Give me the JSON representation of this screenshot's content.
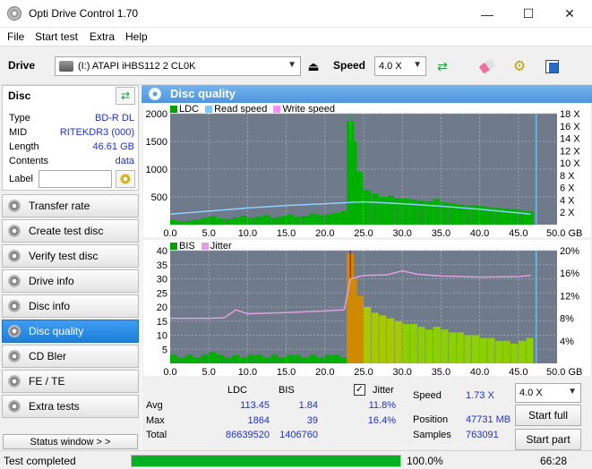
{
  "window": {
    "title": "Opti Drive Control 1.70",
    "minimize": "—",
    "maximize": "☐",
    "close": "✕"
  },
  "menu": [
    "File",
    "Start test",
    "Extra",
    "Help"
  ],
  "drive": {
    "label": "Drive",
    "device": "(I:)  ATAPI iHBS112   2 CL0K",
    "speed_label": "Speed",
    "speed_value": "4.0 X"
  },
  "disc": {
    "header": "Disc",
    "rows": [
      {
        "key": "Type",
        "value": "BD-R DL"
      },
      {
        "key": "MID",
        "value": "RITEKDR3 (000)"
      },
      {
        "key": "Length",
        "value": "46.61 GB"
      },
      {
        "key": "Contents",
        "value": "data"
      }
    ],
    "label_key": "Label",
    "label_value": ""
  },
  "nav": [
    {
      "label": "Transfer rate",
      "active": false
    },
    {
      "label": "Create test disc",
      "active": false
    },
    {
      "label": "Verify test disc",
      "active": false
    },
    {
      "label": "Drive info",
      "active": false
    },
    {
      "label": "Disc info",
      "active": false
    },
    {
      "label": "Disc quality",
      "active": true
    },
    {
      "label": "CD Bler",
      "active": false
    },
    {
      "label": "FE / TE",
      "active": false
    },
    {
      "label": "Extra tests",
      "active": false
    }
  ],
  "status_window_button": "Status window > >",
  "panel_title": "Disc quality",
  "legend_top": [
    "LDC",
    "Read speed",
    "Write speed"
  ],
  "legend_bottom": [
    "BIS",
    "Jitter"
  ],
  "colors": {
    "ldc": "#00a000",
    "read_speed": "#7cc7f5",
    "write_speed": "#ff8cff",
    "bis": "#00a000",
    "jitter": "#e0a0e0",
    "plot_bg": "#6f7a8a",
    "accent": "#2b8ae0"
  },
  "chart_data": [
    {
      "type": "bar",
      "series": [
        {
          "name": "LDC",
          "x": [
            0.5,
            1.5,
            2.5,
            3.5,
            4.5,
            5.5,
            6.5,
            7.5,
            8.5,
            9.5,
            10.5,
            11.5,
            12.5,
            13.5,
            14.5,
            15.5,
            16.5,
            17.5,
            18.5,
            19.5,
            20.5,
            21.5,
            22.5,
            23.3,
            23.7,
            24.5,
            25.5,
            26.5,
            27.5,
            28.5,
            29.5,
            30.5,
            31.5,
            32.5,
            33.5,
            34.5,
            35.5,
            36.5,
            37.5,
            38.5,
            39.5,
            40.5,
            41.5,
            42.5,
            43.5,
            44.5,
            45.5,
            46.5
          ],
          "values": [
            80,
            60,
            70,
            90,
            120,
            150,
            110,
            100,
            130,
            160,
            120,
            140,
            170,
            130,
            150,
            180,
            140,
            160,
            200,
            170,
            190,
            210,
            240,
            1864,
            1500,
            950,
            620,
            560,
            500,
            520,
            480,
            470,
            450,
            430,
            420,
            460,
            400,
            380,
            360,
            350,
            340,
            330,
            310,
            300,
            290,
            280,
            260,
            240
          ]
        },
        {
          "name": "Read speed",
          "x": [
            0,
            5,
            10,
            15,
            20,
            23.3,
            25,
            30,
            35,
            40,
            45,
            46.6
          ],
          "values": [
            1.7,
            2.2,
            2.7,
            3.1,
            3.4,
            3.6,
            3.7,
            3.4,
            3.0,
            2.5,
            1.9,
            1.7
          ]
        }
      ],
      "xlabel": "GB",
      "xlim": [
        0,
        50
      ],
      "ylim_left": [
        0,
        2000
      ],
      "ylim_right": [
        0,
        18
      ],
      "y_ticks_left": [
        500,
        1000,
        1500,
        2000
      ],
      "y_ticks_right": [
        "2 X",
        "4 X",
        "6 X",
        "8 X",
        "10 X",
        "12 X",
        "14 X",
        "16 X",
        "18 X"
      ],
      "x_ticks": [
        "0.0",
        "5.0",
        "10.0",
        "15.0",
        "20.0",
        "25.0",
        "30.0",
        "35.0",
        "40.0",
        "45.0",
        "50.0 GB"
      ]
    },
    {
      "type": "bar",
      "series": [
        {
          "name": "BIS",
          "x": [
            0.5,
            1.5,
            2.5,
            3.5,
            4.5,
            5.5,
            6.5,
            7.5,
            8.5,
            9.5,
            10.5,
            11.5,
            12.5,
            13.5,
            14.5,
            15.5,
            16.5,
            17.5,
            18.5,
            19.5,
            20.5,
            21.5,
            22.5,
            23.3,
            23.7,
            24.5,
            25.5,
            26.5,
            27.5,
            28.5,
            29.5,
            30.5,
            31.5,
            32.5,
            33.5,
            34.5,
            35.5,
            36.5,
            37.5,
            38.5,
            39.5,
            40.5,
            41.5,
            42.5,
            43.5,
            44.5,
            45.5,
            46.5
          ],
          "values": [
            3,
            2,
            3,
            2,
            3,
            4,
            3,
            2,
            3,
            2,
            3,
            3,
            2,
            3,
            2,
            3,
            3,
            2,
            3,
            2,
            3,
            3,
            2,
            39,
            30,
            24,
            20,
            18,
            17,
            16,
            15,
            14,
            14,
            13,
            12,
            13,
            12,
            11,
            11,
            10,
            10,
            9,
            9,
            8,
            8,
            7,
            8,
            9
          ]
        },
        {
          "name": "Jitter",
          "x": [
            0,
            5,
            7,
            8.5,
            10,
            15,
            20,
            22.5,
            23.3,
            25,
            28,
            30,
            32,
            35,
            40,
            45,
            46.6
          ],
          "values": [
            8.0,
            8.0,
            8.1,
            9.5,
            8.8,
            9.0,
            9.3,
            9.5,
            15.0,
            15.6,
            15.7,
            16.4,
            15.8,
            15.5,
            15.3,
            15.4,
            15.6
          ]
        }
      ],
      "xlabel": "GB",
      "xlim": [
        0,
        50
      ],
      "ylim_left": [
        0,
        40
      ],
      "ylim_right": [
        0,
        20
      ],
      "y_ticks_left": [
        5,
        10,
        15,
        20,
        25,
        30,
        35,
        40
      ],
      "y_ticks_right": [
        "4%",
        "8%",
        "12%",
        "16%",
        "20%"
      ],
      "x_ticks": [
        "0.0",
        "5.0",
        "10.0",
        "15.0",
        "20.0",
        "25.0",
        "30.0",
        "35.0",
        "40.0",
        "45.0",
        "50.0 GB"
      ]
    }
  ],
  "stats": {
    "col_ldc": "LDC",
    "col_bis": "BIS",
    "jitter_label": "Jitter",
    "jitter_checked": true,
    "rows": [
      {
        "label": "Avg",
        "ldc": "113.45",
        "bis": "1.84",
        "jitter": "11.8%"
      },
      {
        "label": "Max",
        "ldc": "1864",
        "bis": "39",
        "jitter": "16.4%"
      },
      {
        "label": "Total",
        "ldc": "86639520",
        "bis": "1406760",
        "jitter": ""
      }
    ],
    "speed_label": "Speed",
    "speed_value": "1.73 X",
    "position_label": "Position",
    "position_value": "47731 MB",
    "samples_label": "Samples",
    "samples_value": "763091",
    "speed_select": "4.0 X",
    "start_full": "Start full",
    "start_part": "Start part"
  },
  "status": {
    "text": "Test completed",
    "progress": 100.0,
    "progress_text": "100.0%",
    "time": "66:28"
  }
}
